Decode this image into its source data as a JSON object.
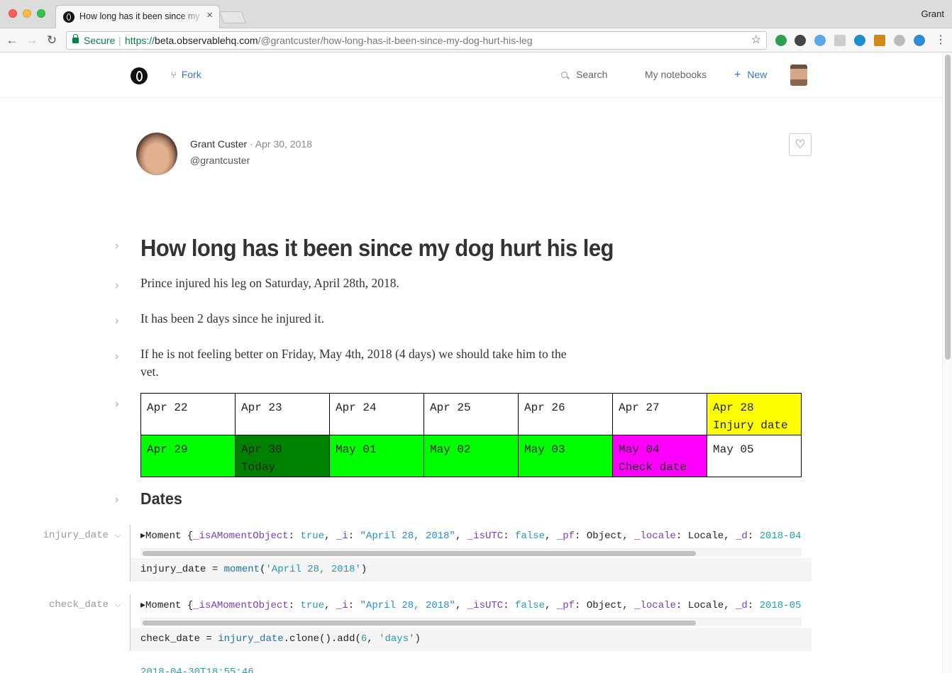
{
  "browser": {
    "tab_title": "How long has it been since my",
    "tab_close": "×",
    "profile": "Grant",
    "secure_label": "Secure",
    "url_scheme": "https://",
    "url_host": "beta.observablehq.com",
    "url_path": "/@grantcuster/how-long-has-it-been-since-my-dog-hurt-his-leg",
    "back": "←",
    "forward": "→",
    "reload": "↻",
    "star": "☆",
    "menu": "⋮",
    "extension_colors": [
      "#2e9e4f",
      "#444444",
      "#5aa9e6",
      "#cccccc",
      "#1b8fd0",
      "#d08a1b",
      "#bbbbbb",
      "#2e8bd8"
    ]
  },
  "header": {
    "fork": "Fork",
    "search": "Search",
    "my_notebooks": "My notebooks",
    "new": "New",
    "new_plus": "+",
    "fork_icon": "⑂"
  },
  "author": {
    "name": "Grant Custer",
    "date": " · Apr 30, 2018",
    "handle": "@grantcuster",
    "like_icon": "♡"
  },
  "notebook": {
    "title": "How long has it been since my dog hurt his leg",
    "p1": "Prince injured his leg on Saturday, April 28th, 2018.",
    "p2": "It has been 2 days since he injured it.",
    "p3": "If he is not feeling better on Friday, May 4th, 2018 (4 days) we should take him to the vet.",
    "section": "Dates",
    "toggle": "›",
    "chevron": "⌵"
  },
  "calendar": {
    "rows": [
      [
        {
          "date": "Apr 22",
          "note": "",
          "color": "#ffffff"
        },
        {
          "date": "Apr 23",
          "note": "",
          "color": "#ffffff"
        },
        {
          "date": "Apr 24",
          "note": "",
          "color": "#ffffff"
        },
        {
          "date": "Apr 25",
          "note": "",
          "color": "#ffffff"
        },
        {
          "date": "Apr 26",
          "note": "",
          "color": "#ffffff"
        },
        {
          "date": "Apr 27",
          "note": "",
          "color": "#ffffff"
        },
        {
          "date": "Apr 28",
          "note": "Injury date",
          "color": "#ffff00"
        }
      ],
      [
        {
          "date": "Apr 29",
          "note": "",
          "color": "#00ff00"
        },
        {
          "date": "Apr 30",
          "note": "Today",
          "color": "#008000"
        },
        {
          "date": "May 01",
          "note": "",
          "color": "#00ff00"
        },
        {
          "date": "May 02",
          "note": "",
          "color": "#00ff00"
        },
        {
          "date": "May 03",
          "note": "",
          "color": "#00ff00"
        },
        {
          "date": "May 04",
          "note": "Check date",
          "color": "#ff00ff"
        },
        {
          "date": "May 05",
          "note": "",
          "color": "#ffffff"
        }
      ]
    ]
  },
  "cells": {
    "injury": {
      "label": "injury_date",
      "out_prefix": "▸Moment {",
      "out_d_value": "2018-04",
      "code_var": "injury_date",
      "code_eq": " = ",
      "code_fn": "moment",
      "code_arg": "'April 28, 2018'"
    },
    "check": {
      "label": "check_date",
      "out_prefix": "▸Moment {",
      "out_d_value": "2018-05",
      "code_var": "check_date",
      "code_eq": " = ",
      "code_ref": "injury_date",
      "code_mid": ".clone().add(",
      "code_num": "6",
      "code_sep": ", ",
      "code_str": "'days'",
      "code_end": ")"
    },
    "moment_fields": {
      "k1": "_isAMomentObject",
      "v1": "true",
      "k2": "_i",
      "v2": "\"April 28, 2018\"",
      "k3": "_isUTC",
      "v3": "false",
      "k4": "_pf",
      "v4": "Object",
      "k5": "_locale",
      "v5": "Locale",
      "k6": "_d"
    },
    "next_partial": "2018-04-30T18:55:46"
  }
}
